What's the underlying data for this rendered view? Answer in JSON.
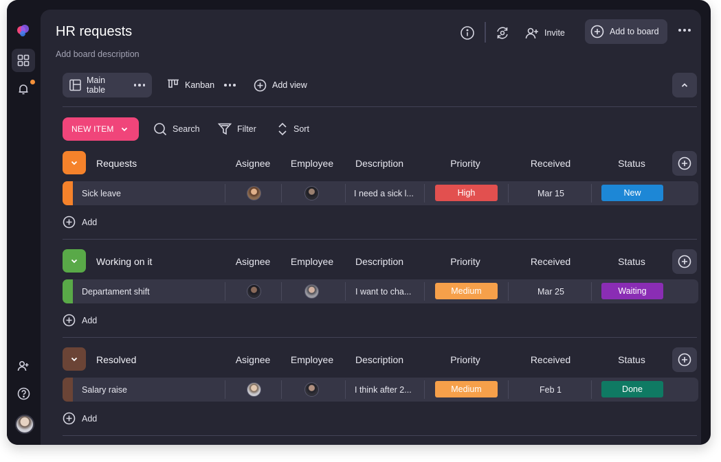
{
  "board": {
    "title": "HR requests",
    "description": "Add board description",
    "invite_label": "Invite",
    "add_to_board_label": "Add to board"
  },
  "views": [
    {
      "label": "Main table",
      "active": true
    },
    {
      "label": "Kanban",
      "active": false
    }
  ],
  "add_view_label": "Add view",
  "toolbar": {
    "new_item_label": "NEW ITEM",
    "search_label": "Search",
    "filter_label": "Filter",
    "sort_label": "Sort"
  },
  "columns": {
    "assignee": "Asignee",
    "employee": "Employee",
    "description": "Description",
    "priority": "Priority",
    "received": "Received",
    "status": "Status"
  },
  "add_label": "Add",
  "groups": [
    {
      "name": "Requests",
      "color": "#f5822b",
      "item": {
        "name": "Sick leave",
        "description": "I need a sick l...",
        "priority": "High",
        "priority_color": "#e2504f",
        "received": "Mar 15",
        "status": "New",
        "status_color": "#1d87d6"
      }
    },
    {
      "name": "Working on it",
      "color": "#59a948",
      "item": {
        "name": "Departament shift",
        "description": "I want to cha...",
        "priority": "Medium",
        "priority_color": "#f6a04a",
        "received": "Mar 25",
        "status": "Waiting",
        "status_color": "#8a2db4"
      }
    },
    {
      "name": "Resolved",
      "color": "#6b4436",
      "item": {
        "name": "Salary raise",
        "description": "I think after 2...",
        "priority": "Medium",
        "priority_color": "#f6a04a",
        "received": "Feb 1",
        "status": "Done",
        "status_color": "#0f7a63"
      }
    }
  ]
}
